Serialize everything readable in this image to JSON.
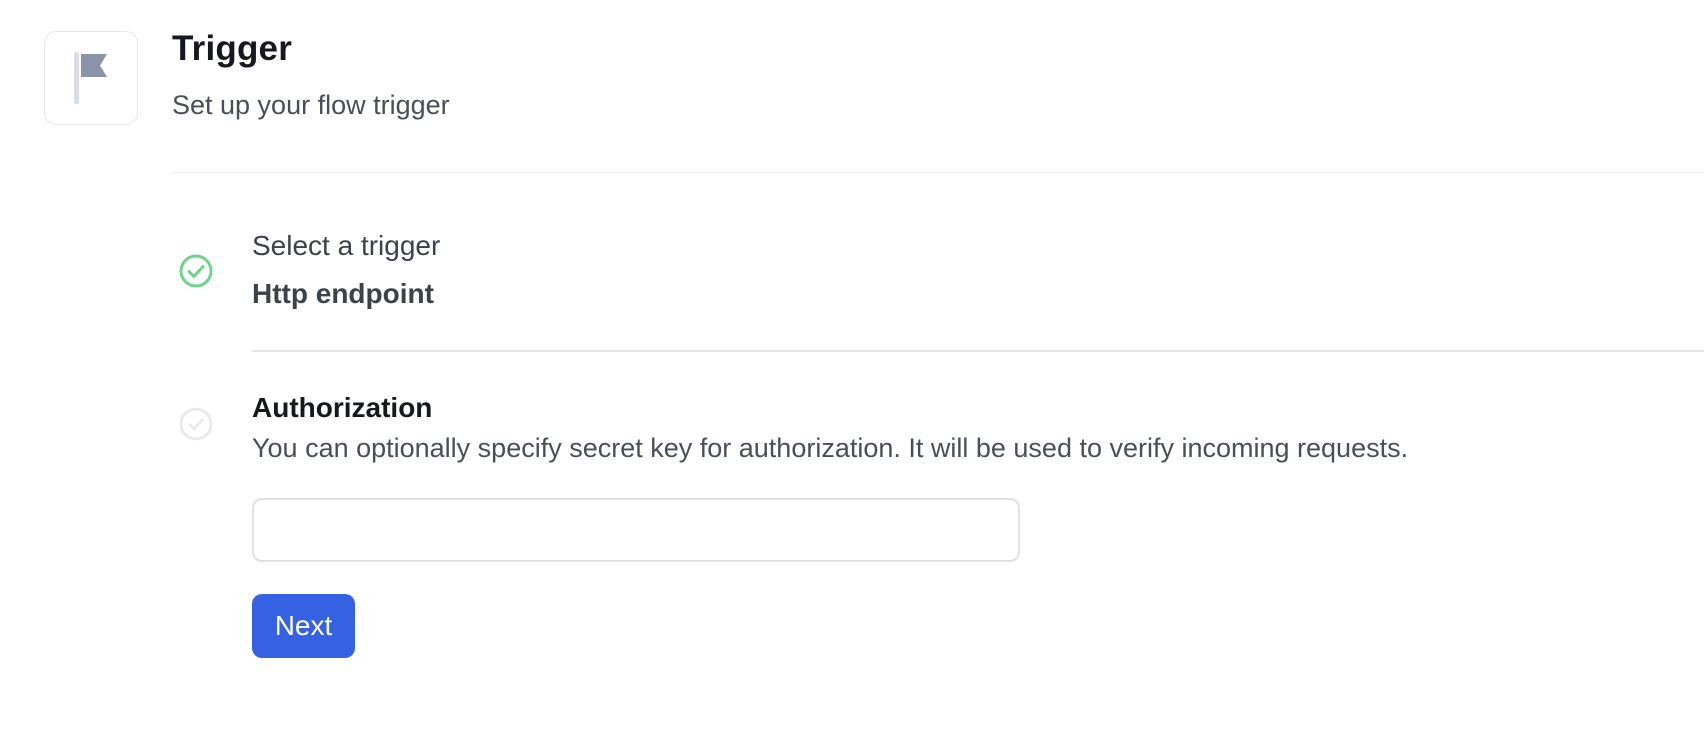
{
  "header": {
    "icon": "flag-icon",
    "title": "Trigger",
    "subtitle": "Set up your flow trigger"
  },
  "steps": [
    {
      "status": "complete",
      "icon": "check-circle-icon",
      "label": "Select a trigger",
      "value": "Http endpoint"
    },
    {
      "status": "active",
      "icon": "check-circle-icon",
      "title": "Authorization",
      "description": "You can optionally specify secret key for authorization. It will be used to verify incoming requests.",
      "input": {
        "value": "",
        "placeholder": ""
      }
    }
  ],
  "actions": {
    "next_label": "Next"
  },
  "colors": {
    "accent": "#3562e3",
    "success": "#6fd38a",
    "inactive_icon": "#e6e8eb",
    "flag": "#8994a8"
  }
}
